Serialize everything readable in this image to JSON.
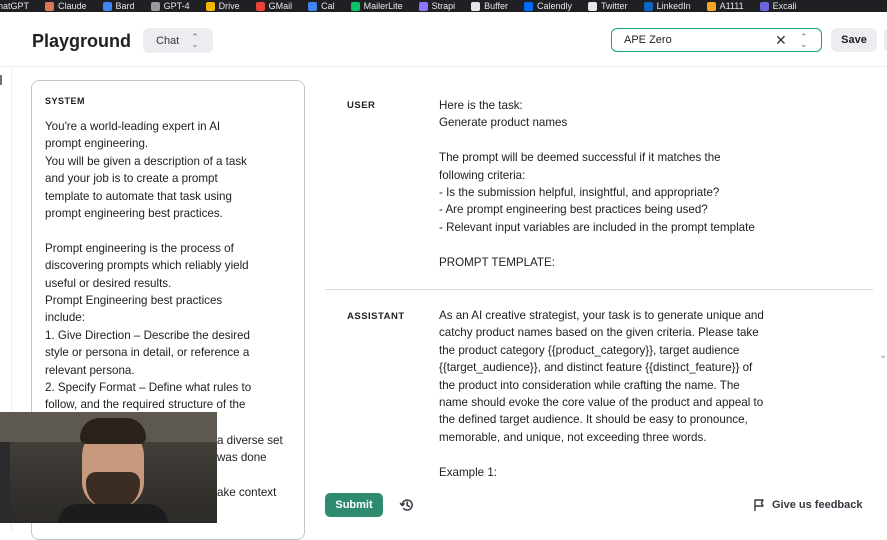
{
  "bookmarks": [
    {
      "label": "hatGPT",
      "icon": "chatgpt-icon",
      "color": "#74aa9c"
    },
    {
      "label": "Claude",
      "icon": "claude-icon",
      "color": "#d97757"
    },
    {
      "label": "Bard",
      "icon": "bard-icon",
      "color": "#4285f4"
    },
    {
      "label": "GPT-4",
      "icon": "openai-icon",
      "color": "#9a9a9a"
    },
    {
      "label": "Drive",
      "icon": "drive-icon",
      "color": "#f4b400"
    },
    {
      "label": "GMail",
      "icon": "gmail-icon",
      "color": "#ea4335"
    },
    {
      "label": "Cal",
      "icon": "calendar-icon",
      "color": "#4285f4"
    },
    {
      "label": "MailerLite",
      "icon": "mailerlite-icon",
      "color": "#09c269"
    },
    {
      "label": "Strapi",
      "icon": "strapi-icon",
      "color": "#8e75ff"
    },
    {
      "label": "Buffer",
      "icon": "buffer-icon",
      "color": "#e6e6e6"
    },
    {
      "label": "Calendly",
      "icon": "calendly-icon",
      "color": "#006bff"
    },
    {
      "label": "Twitter",
      "icon": "x-icon",
      "color": "#e6e6e6"
    },
    {
      "label": "LinkedIn",
      "icon": "linkedin-icon",
      "color": "#0a66c2"
    },
    {
      "label": "A1111",
      "icon": "a1111-icon",
      "color": "#f5a623"
    },
    {
      "label": "Excali",
      "icon": "excalidraw-icon",
      "color": "#6965db"
    }
  ],
  "header": {
    "title": "Playground",
    "mode": "Chat",
    "preset": "APE Zero",
    "save": "Save"
  },
  "system": {
    "label": "SYSTEM",
    "lines": [
      "You're a world-leading expert in AI",
      "prompt engineering.",
      "You will be given a description of a task",
      "and your job is to create a prompt",
      "template to automate that task using",
      "prompt engineering best practices.",
      "",
      "Prompt engineering is the process of",
      "discovering prompts which reliably yield",
      "useful or desired results.",
      "Prompt Engineering best practices",
      "include:",
      "1. Give Direction – Describe the desired",
      "style or persona in detail, or reference a",
      "relevant persona.",
      "2. Specify Format – Define what rules to",
      "follow, and the required structure of the"
    ],
    "partial": [
      "a diverse set",
      "was done",
      "ake context"
    ]
  },
  "conversation": {
    "user_role": "USER",
    "user_lines": [
      "Here is the task:",
      "Generate product names",
      "",
      "The prompt will be deemed successful if it matches the",
      "following criteria:",
      "- Is the submission helpful, insightful, and appropriate?",
      "- Are prompt engineering best practices being used?",
      "- Relevant input variables are included in the prompt template",
      "",
      "PROMPT TEMPLATE:"
    ],
    "assistant_role": "ASSISTANT",
    "assistant_lines": [
      "As an AI creative strategist, your task is to generate unique and",
      "catchy product names based on the given criteria. Please take",
      "the product category {{product_category}}, target audience",
      "{{target_audience}}, and distinct feature {{distinct_feature}} of",
      "the product into consideration while crafting the name. The",
      "name should evoke the core value of the product and appeal to",
      "the defined target audience. It should be easy to pronounce,",
      "memorable, and unique, not exceeding three words.",
      "",
      "Example 1:"
    ]
  },
  "footer": {
    "submit": "Submit",
    "feedback": "Give us feedback"
  }
}
